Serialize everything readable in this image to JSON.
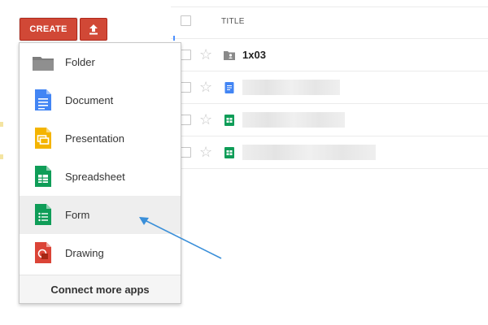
{
  "toolbar": {
    "create_label": "CREATE",
    "upload_icon": "upload-icon"
  },
  "list": {
    "column_title": "TITLE",
    "rows": [
      {
        "icon": "shared-folder-icon",
        "title": "1x03",
        "starred": false
      },
      {
        "icon": "document-icon",
        "title": "",
        "starred": false
      },
      {
        "icon": "spreadsheet-icon",
        "title": "",
        "starred": false
      },
      {
        "icon": "spreadsheet-icon",
        "title": "",
        "starred": false
      }
    ]
  },
  "create_menu": {
    "items": [
      {
        "label": "Folder",
        "icon": "folder-icon"
      },
      {
        "label": "Document",
        "icon": "document-icon"
      },
      {
        "label": "Presentation",
        "icon": "presentation-icon"
      },
      {
        "label": "Spreadsheet",
        "icon": "spreadsheet-icon"
      },
      {
        "label": "Form",
        "icon": "form-icon",
        "highlighted": true
      },
      {
        "label": "Drawing",
        "icon": "drawing-icon"
      }
    ],
    "footer_label": "Connect more apps"
  },
  "annotation": {
    "arrow_color": "#3a8fd9"
  },
  "colors": {
    "create_red": "#d14836",
    "doc_blue": "#4285f4",
    "sheet_green": "#0f9d58",
    "slides_yellow": "#f4b400",
    "drawing_red": "#db4437"
  }
}
